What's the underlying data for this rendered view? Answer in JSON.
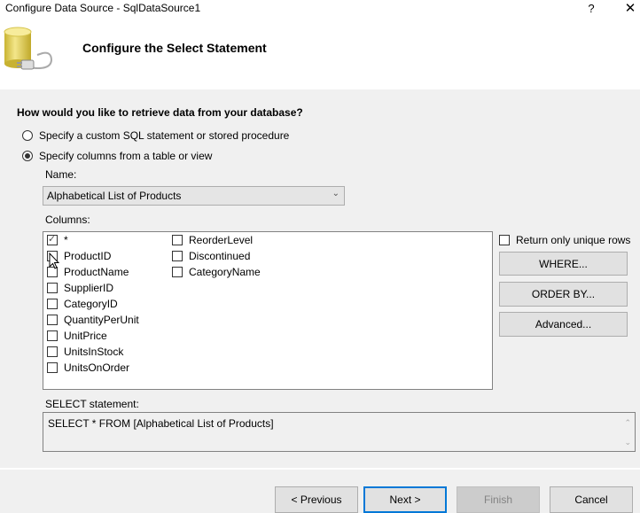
{
  "window": {
    "title": "Configure Data Source - SqlDataSource1",
    "help_label": "?",
    "close_label": "✕"
  },
  "header": {
    "title": "Configure the Select Statement",
    "icon": "database-plug-icon"
  },
  "main": {
    "question": "How would you like to retrieve data from your database?",
    "options": [
      {
        "label": "Specify a custom SQL statement or stored procedure",
        "selected": false
      },
      {
        "label": "Specify columns from a table or view",
        "selected": true
      }
    ],
    "name_label": "Name:",
    "name_value": "Alphabetical List of Products",
    "columns_label": "Columns:",
    "columns": [
      {
        "label": "*",
        "checked": true
      },
      {
        "label": "ProductID",
        "checked": false
      },
      {
        "label": "ProductName",
        "checked": false
      },
      {
        "label": "SupplierID",
        "checked": false
      },
      {
        "label": "CategoryID",
        "checked": false
      },
      {
        "label": "QuantityPerUnit",
        "checked": false
      },
      {
        "label": "UnitPrice",
        "checked": false
      },
      {
        "label": "UnitsInStock",
        "checked": false
      },
      {
        "label": "UnitsOnOrder",
        "checked": false
      },
      {
        "label": "ReorderLevel",
        "checked": false
      },
      {
        "label": "Discontinued",
        "checked": false
      },
      {
        "label": "CategoryName",
        "checked": false
      }
    ],
    "unique_rows_label": "Return only unique rows",
    "unique_rows_checked": false,
    "where_label": "WHERE...",
    "order_by_label": "ORDER BY...",
    "advanced_label": "Advanced...",
    "select_label": "SELECT statement:",
    "select_value": "SELECT * FROM [Alphabetical List of Products]"
  },
  "footer": {
    "previous_label": "< Previous",
    "next_label": "Next >",
    "finish_label": "Finish",
    "cancel_label": "Cancel"
  }
}
